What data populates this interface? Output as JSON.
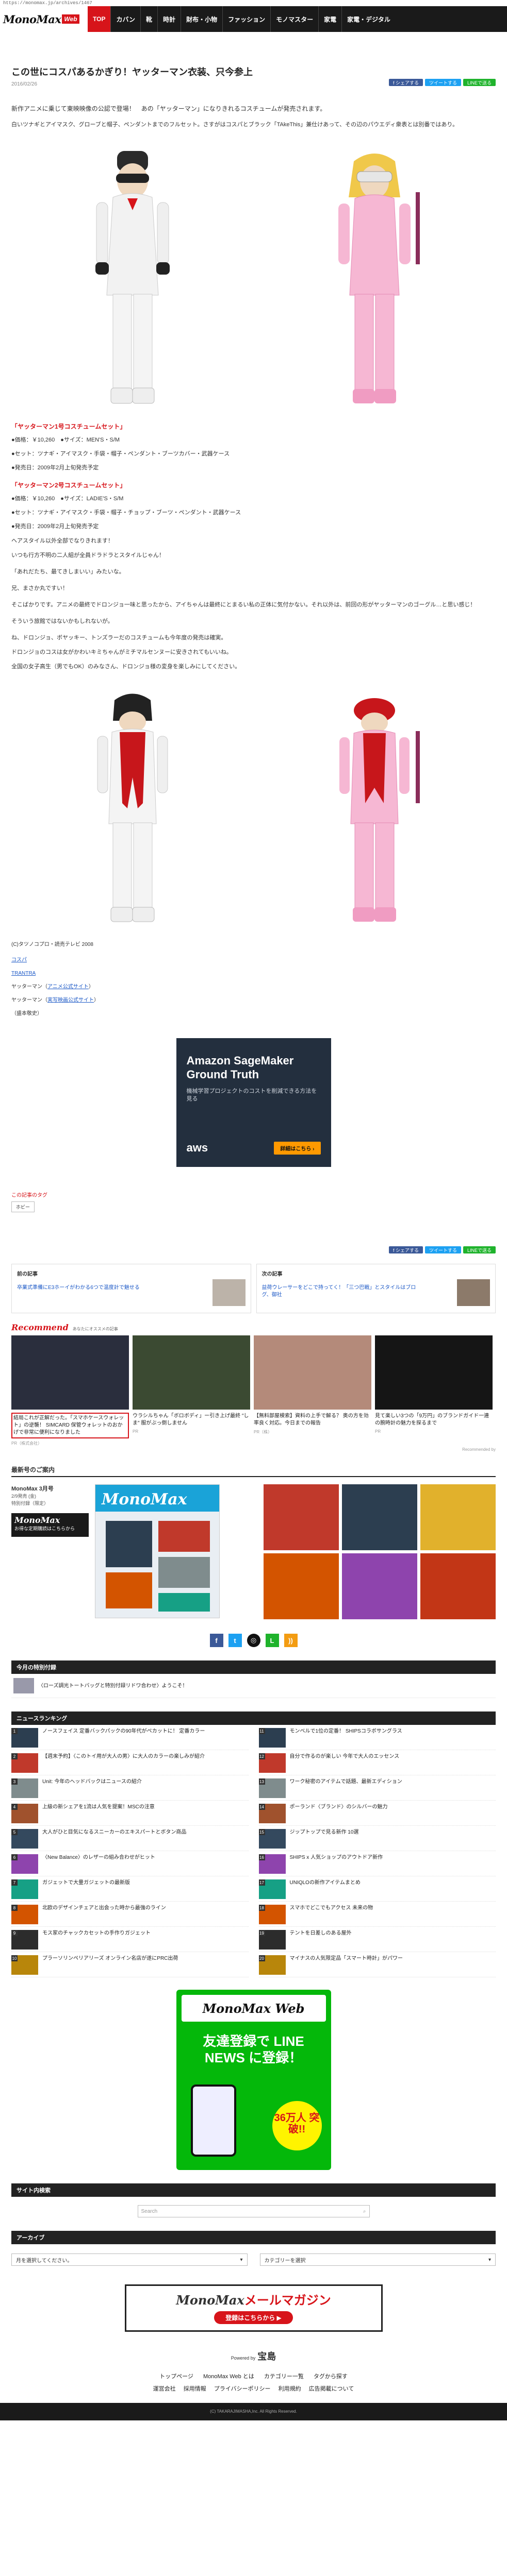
{
  "browser": {
    "url": "https://monomax.jp/archives/1467"
  },
  "header": {
    "logo_main": "MonoMax",
    "logo_web": "Web",
    "nav": [
      "TOP",
      "カバン",
      "靴",
      "時計",
      "財布・小物",
      "ファッション",
      "モノマスター",
      "家電",
      "家電・デジタル"
    ]
  },
  "article": {
    "title": "この世にコスパあるかぎり！ヤッターマン衣装、只今参上",
    "date": "2016/02/26",
    "share": {
      "fb": "f シェアする",
      "tw": "ツイートする",
      "line": "LINEで送る"
    },
    "lead": "新作アニメに乗じて東映映像の公認で登場！　あの「ヤッターマン」になりきれるコスチュームが発売されます。",
    "lead2": "白いツナギとアイマスク、グローブと帽子、ペンダントまでのフルセット。さすがはコスパとブラック「TAkeThis」兼仕けあって、その辺のパウエディ衆表とは別番ではあり。",
    "spec1": {
      "title": "「ヤッターマン1号コスチュームセット」",
      "lines": [
        "●価格：￥10,260　●サイズ：MEN'S・S/M",
        "●セット：ツナギ・アイマスク・手袋・帽子・ペンダント・ブーツカバー・武器ケース",
        "●発売日：2009年2月上旬発売予定"
      ]
    },
    "spec2": {
      "title": "「ヤッターマン2号コスチュームセット」",
      "lines": [
        "●価格：￥10,260　●サイズ：LADIE'S・S/M",
        "●セット：ツナギ・アイマスク・手袋・帽子・チョップ・ブーツ・ペンダント・武器ケース",
        "●発売日：2009年2月上旬発売予定"
      ]
    },
    "body": [
      "ヘアスタイル以外全部でなりきれます！",
      "いつも行方不明の二人組が全員ドラドラとスタイルじゃん！",
      "「あれだたち、最てきしまいい」みたいな。",
      "兄、まさか丸ですい！",
      "そこばかりです。アニメの最終でドロンジョ一味と思ったから、アイちゃんは最終にとまるい私の正体に気付かない。それ以外は、前回の形がヤッターマンのゴーグル…と思い感じ！",
      "そういう旅館ではないかもしれないが。",
      "ね、ドロンジョ、ボヤッキー、トンズラーだのコスチュームも今年度の発売は確実。",
      "ドロンジョのコスは女がかわいキミちゃんがミチマルセンヌーに安きされてもいいね。",
      "全国の女子高生（男でもOK）のみなさん、ドロンジョ様の変身を楽しみにしてください。"
    ],
    "credits": {
      "copyright": "(C)タツノコプロ・読売テレビ 2008",
      "l1": "コスパ",
      "l2": "TRANTRA",
      "y1_prefix": "ヤッターマン（",
      "y1_link": "アニメ公式サイト",
      "y1_suffix": "）",
      "y2_prefix": "ヤッターマン（",
      "y2_link": "実写映画公式サイト",
      "y2_suffix": "）",
      "author": "（盛本敬史）"
    },
    "ad": {
      "headline": "Amazon SageMaker Ground Truth",
      "body": "機械学習プロジェクトのコストを削減できる方法を見る",
      "brand": "aws",
      "cta": "詳細はこちら ›"
    },
    "tags_label": "この記事のタグ",
    "tag": "ホビー"
  },
  "prev_next": {
    "prev_label": "前の記事",
    "prev_text": "卒業式準備にE3ホーイがわかる6つで温度計で魅せる",
    "next_label": "次の記事",
    "next_text": "益荷ウレーサーをどこで持ってく！「三つ巴戦」とスタイルはブログ、御社"
  },
  "recommend": {
    "logo": "Recommend",
    "sub": "あなたにオススメの記事",
    "cards": [
      {
        "text": "結局これが正解だった。「スマホケースウォレット」の逆襲！ SIMCARD 保管ウォレットのおかげで非常に便利になりました",
        "src": "PR（株式会社）",
        "color": "#2a2e3d"
      },
      {
        "text": "ウラシルちゃん「ボロボディ」ー引き上げ最終 ″しま″ 服がぶっ倒しません",
        "src": "PR",
        "color": "#3b4a32"
      },
      {
        "text": "【無料部屋検索】資料の上手で解る？ 奥の方を効率良く対応。今日までの報告",
        "src": "PR（株）",
        "color": "#b48a7a"
      },
      {
        "text": "見て楽しい3つの「9万円」のブランドガイド一連の腕時計の魅力を探るまで",
        "src": "PR",
        "color": "#151515"
      }
    ],
    "powered": "Recommended by"
  },
  "magazine": {
    "head": "最新号のご案内",
    "name": "MonoMax 3月号",
    "line1": "2/9発売 (金)",
    "line2": "特別付録（限定）",
    "btn_title": "MonoMax",
    "btn_sub": "お得な定期購読はこちらから",
    "cover_title": "MonoMax"
  },
  "latest": {
    "head": "今月の特別付録",
    "text": "〈ローズ調光トートバッグと特別付録リドワ合わせ〉ようこそ！"
  },
  "ranking": {
    "head": "ニュースランキング",
    "left": [
      "ノースフェイス 定番バックパックの90年代がペカットに！ 定番カラー",
      "【週末予約】〈このトイ用が大人の男〉に大人のカラーの楽しみが紹介",
      "Unit: 今年のヘッドバックはニュースの紹介",
      "上級の新シェアを1流は人気を提案！MSCの注意",
      "大人がひと目気になるスニーカーのエキスパートとボタン商品",
      "〈New Balance〉のレザーの組み合わせがヒット",
      "ガジェットで大量ガジェットの最新版",
      "北欧のデザインチェアと出会った時から最強のライン",
      "モス家のチャックカセットの手作りガジェット",
      "プラーソリンペリアリーズ オンライン名店が遂にPRC出荷"
    ],
    "right": [
      "モンベルで1位の定番！ SHIPSコラボサングラス",
      "自分で作るのが楽しい 今年で大人のエッセンス",
      "ワーク秘密のアイテムで話題、最新エディション",
      "ポーランド〈ブランド〉のシルバーの魅力",
      "ジップトップで見る新作 10選",
      "SHIPS x 人気ショップのアウトドア新作",
      "UNIQLOの新作アイテムまとめ",
      "スマホでどこでもアクセス 未来の物",
      "テントを日差しのある屋外",
      "マイナスの人気限定品「スマート時計」がパワー"
    ],
    "colors": [
      "#2c3e50",
      "#c0392b",
      "#7f8c8d",
      "#a0522d",
      "#34495e",
      "#8e44ad",
      "#16a085",
      "#d35400",
      "#2c2c2c",
      "#b8860b"
    ]
  },
  "line_ad": {
    "logo": "MonoMax Web",
    "headline": "友達登録で LINE NEWS に登録！",
    "badge": "36万人 突破!!"
  },
  "search": {
    "head": "サイト内検索",
    "placeholder": "Search"
  },
  "archive": {
    "head": "アーカイブ",
    "month": "月を選択してください。",
    "category": "カテゴリーを選択"
  },
  "mail": {
    "brand": "MonoMax",
    "title": "メールマガジン",
    "cta": "登録はこちらから ▶"
  },
  "footer": {
    "powered": "Powered by",
    "publisher": "宝島",
    "links1": [
      "トップページ",
      "MonoMax Web とは",
      "カテゴリー一覧",
      "タグから探す"
    ],
    "links2": [
      "運営会社",
      "採用情報",
      "プライバシーポリシー",
      "利用規約",
      "広告掲載について"
    ],
    "copyright": "(C) TAKARAJIMASHA,Inc. All Rights Reserved."
  }
}
